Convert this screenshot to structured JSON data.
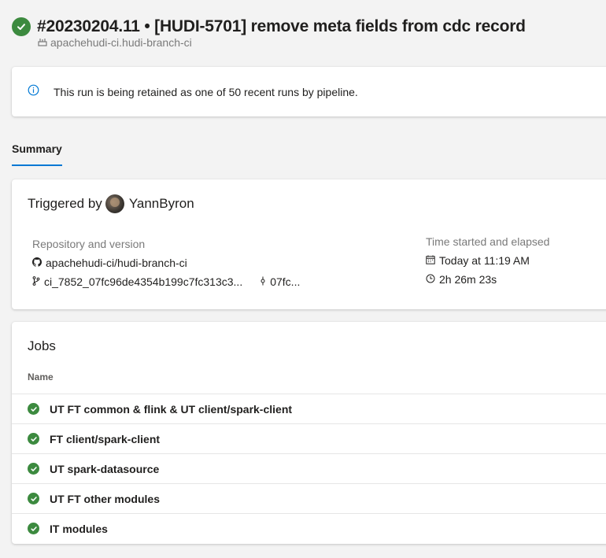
{
  "header": {
    "run_title": "#20230204.11 • [HUDI-5701] remove meta fields from cdc record",
    "pipeline_name": "apachehudi-ci.hudi-branch-ci",
    "status_icon": "success-check-icon",
    "status_color": "#3c8a3f"
  },
  "banner": {
    "icon": "info-icon",
    "text": "This run is being retained as one of 50 recent runs by pipeline."
  },
  "tabs": [
    {
      "label": "Summary",
      "selected": true
    }
  ],
  "summary": {
    "triggered_by_label": "Triggered by",
    "triggered_by_user": "YannByron",
    "repo_label": "Repository and version",
    "repo_name": "apachehudi-ci/hudi-branch-ci",
    "branch": "ci_7852_07fc96de4354b199c7fc313c3...",
    "commit": "07fc...",
    "time_label": "Time started and elapsed",
    "started": "Today at 11:19 AM",
    "elapsed": "2h 26m 23s"
  },
  "jobs": {
    "title": "Jobs",
    "column_name": "Name",
    "items": [
      {
        "name": "UT FT common & flink & UT client/spark-client",
        "status": "succeeded"
      },
      {
        "name": "FT client/spark-client",
        "status": "succeeded"
      },
      {
        "name": "UT spark-datasource",
        "status": "succeeded"
      },
      {
        "name": "UT FT other modules",
        "status": "succeeded"
      },
      {
        "name": "IT modules",
        "status": "succeeded"
      }
    ]
  },
  "colors": {
    "accent": "#0078d4",
    "success": "#3c8a3f",
    "background": "#f3f3f3"
  }
}
